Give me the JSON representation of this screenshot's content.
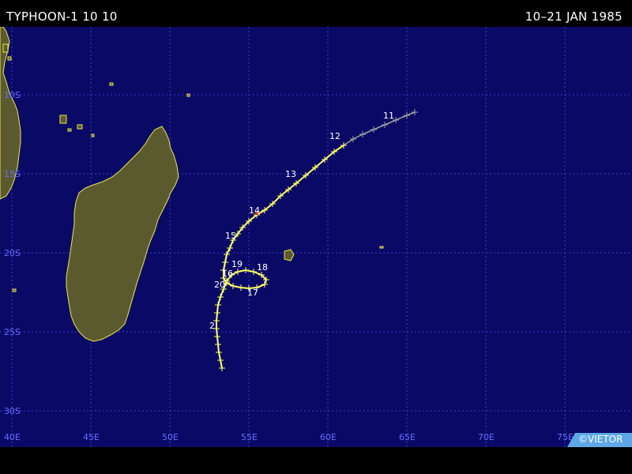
{
  "header": {
    "title": "TYPHOON-1 10 10",
    "date_range": "10–21 JAN 1985"
  },
  "map": {
    "lon_range": [
      40,
      80
    ],
    "lat_range": [
      -8.5,
      -32
    ],
    "lon_labels": [
      "40E",
      "45E",
      "50E",
      "55E",
      "60E",
      "65E",
      "70E",
      "75E"
    ],
    "lat_labels": [
      "10S",
      "15S",
      "20S",
      "25S",
      "30S"
    ],
    "colors": {
      "ocean": "#0a0a66",
      "land": "#5b5a2f",
      "coast": "#e8e84a",
      "grid": "#3a3acc",
      "grid_labels": "#6a6aff",
      "track": "#ffff66",
      "track_early": "#a0a0a0",
      "day_labels": "#ffffff"
    }
  },
  "track": {
    "points": [
      [
        65.5,
        -11.1
      ],
      [
        65.0,
        -11.3
      ],
      [
        64.3,
        -11.6
      ],
      [
        63.6,
        -11.9
      ],
      [
        62.9,
        -12.2
      ],
      [
        62.2,
        -12.5
      ],
      [
        61.6,
        -12.8
      ],
      [
        61.0,
        -13.2
      ],
      [
        60.4,
        -13.6
      ],
      [
        59.8,
        -14.1
      ],
      [
        59.2,
        -14.6
      ],
      [
        58.6,
        -15.1
      ],
      [
        58.0,
        -15.6
      ],
      [
        57.5,
        -16.0
      ],
      [
        57.0,
        -16.4
      ],
      [
        56.5,
        -16.9
      ],
      [
        56.0,
        -17.3
      ],
      [
        55.5,
        -17.6
      ],
      [
        55.0,
        -18.0
      ],
      [
        54.6,
        -18.4
      ],
      [
        54.3,
        -18.8
      ],
      [
        54.0,
        -19.2
      ],
      [
        53.8,
        -19.7
      ],
      [
        53.6,
        -20.1
      ],
      [
        53.5,
        -20.6
      ],
      [
        53.4,
        -21.1
      ],
      [
        53.4,
        -21.6
      ],
      [
        53.6,
        -21.9
      ],
      [
        54.0,
        -22.1
      ],
      [
        54.5,
        -22.2
      ],
      [
        55.0,
        -22.25
      ],
      [
        55.5,
        -22.2
      ],
      [
        56.0,
        -22.0
      ],
      [
        56.1,
        -21.7
      ],
      [
        55.8,
        -21.4
      ],
      [
        55.3,
        -21.2
      ],
      [
        54.8,
        -21.1
      ],
      [
        54.3,
        -21.2
      ],
      [
        53.9,
        -21.4
      ],
      [
        53.6,
        -21.8
      ],
      [
        53.4,
        -22.3
      ],
      [
        53.2,
        -22.8
      ],
      [
        53.05,
        -23.3
      ],
      [
        53.0,
        -23.8
      ],
      [
        52.95,
        -24.3
      ],
      [
        52.95,
        -24.8
      ],
      [
        53.0,
        -25.3
      ],
      [
        53.05,
        -25.8
      ],
      [
        53.1,
        -26.3
      ],
      [
        53.2,
        -26.8
      ],
      [
        53.3,
        -27.3
      ]
    ],
    "early_count": 7,
    "storm_marker": [
      55.5,
      -17.5
    ],
    "day_labels": [
      {
        "text": "11",
        "lon": 63.5,
        "lat": -11.5
      },
      {
        "text": "12",
        "lon": 60.1,
        "lat": -12.8
      },
      {
        "text": "13",
        "lon": 57.3,
        "lat": -15.2
      },
      {
        "text": "14",
        "lon": 55.0,
        "lat": -17.5
      },
      {
        "text": "15",
        "lon": 53.5,
        "lat": -19.1
      },
      {
        "text": "16",
        "lon": 53.3,
        "lat": -21.5
      },
      {
        "text": "18",
        "lon": 55.5,
        "lat": -21.1
      },
      {
        "text": "19",
        "lon": 53.9,
        "lat": -20.9
      },
      {
        "text": "20",
        "lon": 52.8,
        "lat": -22.2
      },
      {
        "text": "17",
        "lon": 54.9,
        "lat": -22.7
      },
      {
        "text": "2",
        "lon": 52.5,
        "lat": -24.8
      }
    ]
  },
  "credit": "©VIETOR"
}
